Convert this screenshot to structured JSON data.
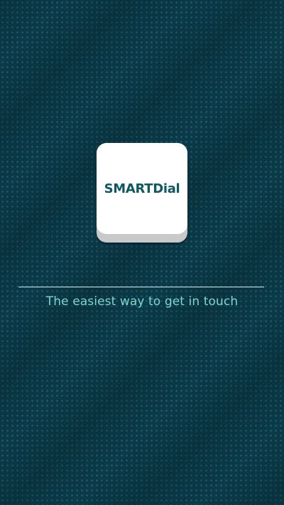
{
  "app": {
    "logo_text": "SMARTDial",
    "tagline": "The easiest way to get in touch"
  },
  "colors": {
    "background": "#0c3a48",
    "pattern_dot": "#288ca0",
    "logo_text": "#0e5763",
    "tagline": "#7ed6cf",
    "divider": "#d9e6ea"
  }
}
